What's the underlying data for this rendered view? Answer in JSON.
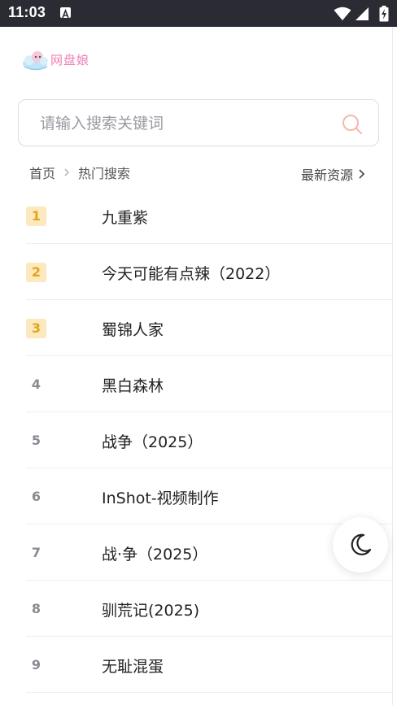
{
  "status_bar": {
    "time": "11:03",
    "left_icon": "a-app-icon",
    "right_icons": [
      "wifi-icon",
      "signal-icon",
      "battery-charging-icon"
    ]
  },
  "logo": {
    "text": "网盘娘",
    "icon": "cloud-mascot-icon"
  },
  "search": {
    "placeholder": "请输入搜索关键词",
    "value": "",
    "icon": "search-icon"
  },
  "breadcrumb": {
    "home": "首页",
    "current": "热门搜索"
  },
  "latest_link": {
    "label": "最新资源"
  },
  "hot_list": [
    {
      "rank": "1",
      "title": "九重紫"
    },
    {
      "rank": "2",
      "title": "今天可能有点辣（2022）"
    },
    {
      "rank": "3",
      "title": "蜀锦人家"
    },
    {
      "rank": "4",
      "title": "黑白森林"
    },
    {
      "rank": "5",
      "title": "战争（2025）"
    },
    {
      "rank": "6",
      "title": "InShot-视频制作"
    },
    {
      "rank": "7",
      "title": "战·争（2025）"
    },
    {
      "rank": "8",
      "title": "驯荒记(2025)"
    },
    {
      "rank": "9",
      "title": "无耻混蛋"
    }
  ],
  "theme_toggle": {
    "icon": "moon-icon"
  },
  "colors": {
    "accent": "#f07db5",
    "rank_top_bg": "#fde9be",
    "rank_top_text": "#e3a41b",
    "rank_normal": "#8a8a94",
    "search_icon": "#f6b7b0",
    "status_bar": "#2b2b33"
  }
}
